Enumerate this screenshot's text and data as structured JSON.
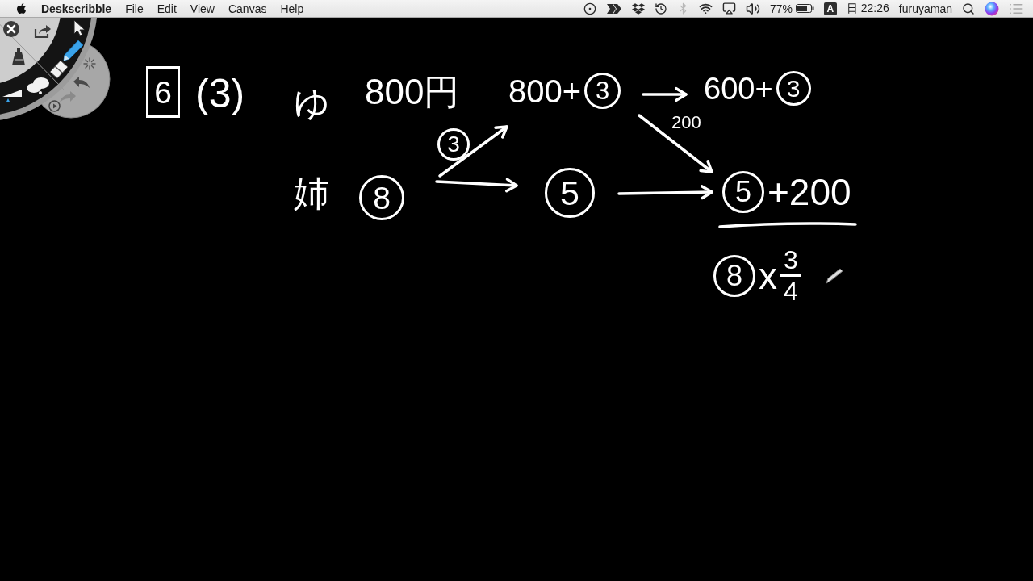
{
  "menu_bar": {
    "app_name": "Deskscribble",
    "menus": [
      "File",
      "Edit",
      "View",
      "Canvas",
      "Help"
    ],
    "bluetooth_on": false,
    "battery": "77%",
    "input_source": "A",
    "clock": "日 22:26",
    "user": "furuyaman"
  },
  "palette": {
    "tools": [
      {
        "kind": "pointer",
        "selected": false
      },
      {
        "kind": "pen",
        "selected": true
      },
      {
        "kind": "eraser",
        "selected": false
      }
    ]
  },
  "board": {
    "notes": [
      {
        "parts": [
          {
            "kind": "boxed",
            "text": "6"
          }
        ]
      },
      {
        "parts": [
          {
            "kind": "plain",
            "text": "(3)"
          }
        ]
      },
      {
        "parts": [
          {
            "kind": "plain",
            "text": "ゆ"
          }
        ]
      },
      {
        "parts": [
          {
            "kind": "plain",
            "text": "800円"
          }
        ]
      },
      {
        "parts": [
          {
            "kind": "plain",
            "text": "800+"
          },
          {
            "kind": "circled",
            "text": "3"
          }
        ]
      },
      {
        "parts": [
          {
            "kind": "plain",
            "text": "600+"
          },
          {
            "kind": "circled",
            "text": "3"
          }
        ]
      },
      {
        "parts": [
          {
            "kind": "plain",
            "text": "200"
          }
        ]
      },
      {
        "parts": [
          {
            "kind": "circled",
            "text": "3"
          }
        ]
      },
      {
        "parts": [
          {
            "kind": "plain",
            "text": "姉"
          }
        ]
      },
      {
        "parts": [
          {
            "kind": "circled",
            "text": "8"
          }
        ]
      },
      {
        "parts": [
          {
            "kind": "circled",
            "text": "5"
          }
        ]
      },
      {
        "parts": [
          {
            "kind": "circled",
            "text": "5"
          },
          {
            "kind": "plain",
            "text": "+200"
          }
        ]
      },
      {
        "parts": [
          {
            "kind": "circled",
            "text": "8"
          },
          {
            "kind": "plain",
            "text": "x"
          },
          {
            "kind": "fraction",
            "numerator": "3",
            "denominator": "4"
          }
        ]
      }
    ]
  }
}
